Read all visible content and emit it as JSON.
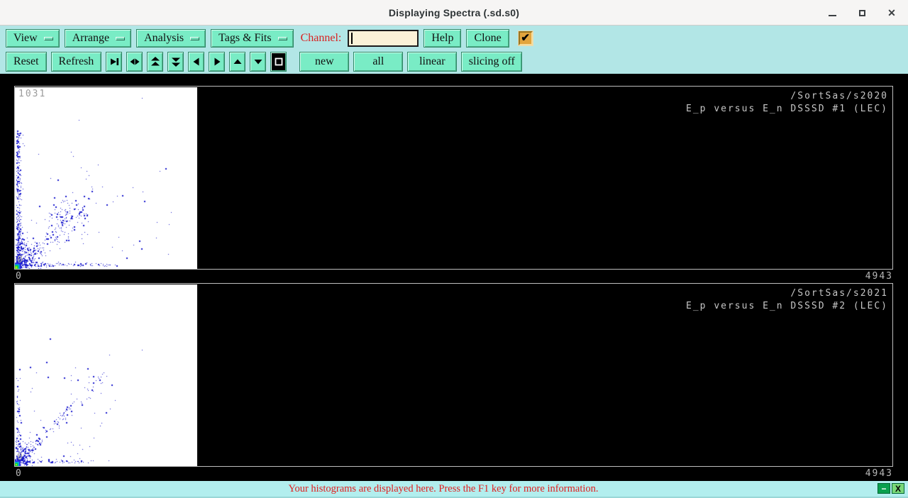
{
  "window": {
    "title": "Displaying Spectra (.sd.s0)",
    "controls": {
      "minimize_glyph": "—",
      "maximize_glyph": "▫",
      "close_glyph": "✕"
    }
  },
  "toolbar": {
    "menus": [
      {
        "label": "View"
      },
      {
        "label": "Arrange"
      },
      {
        "label": "Analysis"
      },
      {
        "label": "Tags & Fits"
      }
    ],
    "channel": {
      "label": "Channel:",
      "value": "",
      "placeholder": ""
    },
    "buttons": {
      "help": "Help",
      "clone": "Clone",
      "reset": "Reset",
      "refresh": "Refresh",
      "new": "new",
      "all": "all",
      "linear": "linear",
      "slicing": "slicing off"
    },
    "checkbox": {
      "checked": true,
      "glyph": "✔"
    },
    "nav_icons": [
      "skip-to-edge-icon",
      "expand-horizontal-icon",
      "scroll-up-fast-icon",
      "scroll-down-fast-icon",
      "scroll-left-icon",
      "scroll-right-icon",
      "scroll-up-icon",
      "scroll-down-icon",
      "full-view-icon"
    ]
  },
  "panels": [
    {
      "path": "/SortSas/s2020",
      "title": "E_p versus E_n DSSSD #1 (LEC)",
      "max_count": "1031",
      "zero_label": "0",
      "x_min": "0",
      "x_max": "4943",
      "scatter": {
        "seed": 7,
        "point_color": "#1a1acd",
        "clusters": [
          {
            "type": "vstrip",
            "x": 0.008,
            "sx": 0.012,
            "y0": 0.0,
            "y1": 0.77,
            "bias": 1.9,
            "n": 430
          },
          {
            "type": "gauss",
            "cx": 0.035,
            "cy": 0.055,
            "sx": 0.04,
            "sy": 0.05,
            "n": 260
          },
          {
            "type": "diag",
            "x0": 0.0,
            "x1": 0.45,
            "slope": 0.8,
            "spread": 0.045,
            "bias": 1.7,
            "n": 190
          },
          {
            "type": "gauss",
            "cx": 0.27,
            "cy": 0.3,
            "sx": 0.065,
            "sy": 0.05,
            "n": 90
          },
          {
            "type": "hband",
            "y": 0.012,
            "sy": 0.01,
            "x0": 0.0,
            "x1": 0.56,
            "bias": 1.5,
            "n": 130
          },
          {
            "type": "uniform",
            "x0": 0.02,
            "x1": 0.85,
            "y0": 0.02,
            "y1": 0.72,
            "n": 40
          }
        ],
        "extra_points": [
          [
            0.7,
            0.94
          ],
          [
            0.35,
            0.82
          ],
          [
            0.83,
            0.55
          ],
          [
            0.71,
            0.37
          ],
          [
            0.86,
            0.31
          ],
          [
            0.48,
            0.45
          ],
          [
            0.13,
            0.63
          ],
          [
            0.59,
            0.4
          ]
        ],
        "hotspot": {
          "layers": [
            {
              "size": 13,
              "color": "#2a2ae0"
            },
            {
              "size": 9,
              "color": "#00b4f0"
            },
            {
              "size": 6,
              "color": "#00cc44"
            },
            {
              "size": 3,
              "color": "#b4f000"
            }
          ]
        }
      }
    },
    {
      "path": "/SortSas/s2021",
      "title": "E_p versus E_n DSSSD #2 (LEC)",
      "max_count": "",
      "zero_label": "0",
      "x_min": "0",
      "x_max": "4943",
      "scatter": {
        "seed": 13,
        "point_color": "#1a1acd",
        "clusters": [
          {
            "type": "gauss",
            "cx": 0.03,
            "cy": 0.05,
            "sx": 0.035,
            "sy": 0.045,
            "n": 240
          },
          {
            "type": "diag",
            "x0": 0.0,
            "x1": 0.52,
            "slope": 1.0,
            "spread": 0.025,
            "bias": 1.9,
            "n": 160
          },
          {
            "type": "vstrip",
            "x": 0.008,
            "sx": 0.01,
            "y0": 0.0,
            "y1": 0.5,
            "bias": 2.0,
            "n": 60
          },
          {
            "type": "hband",
            "y": 0.012,
            "sy": 0.01,
            "x0": 0.0,
            "x1": 0.42,
            "bias": 1.5,
            "n": 70
          },
          {
            "type": "uniform",
            "x0": 0.01,
            "x1": 0.55,
            "y0": 0.02,
            "y1": 0.55,
            "n": 55
          }
        ],
        "extra_points": [
          [
            0.7,
            0.64
          ],
          [
            0.19,
            0.7
          ],
          [
            0.52,
            0.61
          ],
          [
            0.55,
            0.36
          ],
          [
            0.31,
            0.47
          ],
          [
            0.17,
            0.57
          ]
        ],
        "hotspot": {
          "layers": [
            {
              "size": 12,
              "color": "#2a2ae0"
            },
            {
              "size": 8,
              "color": "#00b4f0"
            },
            {
              "size": 5,
              "color": "#00cc44"
            },
            {
              "size": 2,
              "color": "#b4f000"
            }
          ]
        }
      }
    }
  ],
  "status": {
    "message": "Your histograms are displayed here. Press the F1 key for more information.",
    "minimize_label": "−",
    "close_label": "X"
  },
  "colors": {
    "button_bg": "#79ecc5",
    "toolbar_bg": "#b2e6e6",
    "statusbar_bg": "#b2eeee",
    "checkbox_bg": "#e2a43d",
    "channel_entry_bg": "#fbf2d8",
    "red_text": "#d92222",
    "panel_text": "#c6c6c6",
    "point_blue": "#1a1acd"
  }
}
